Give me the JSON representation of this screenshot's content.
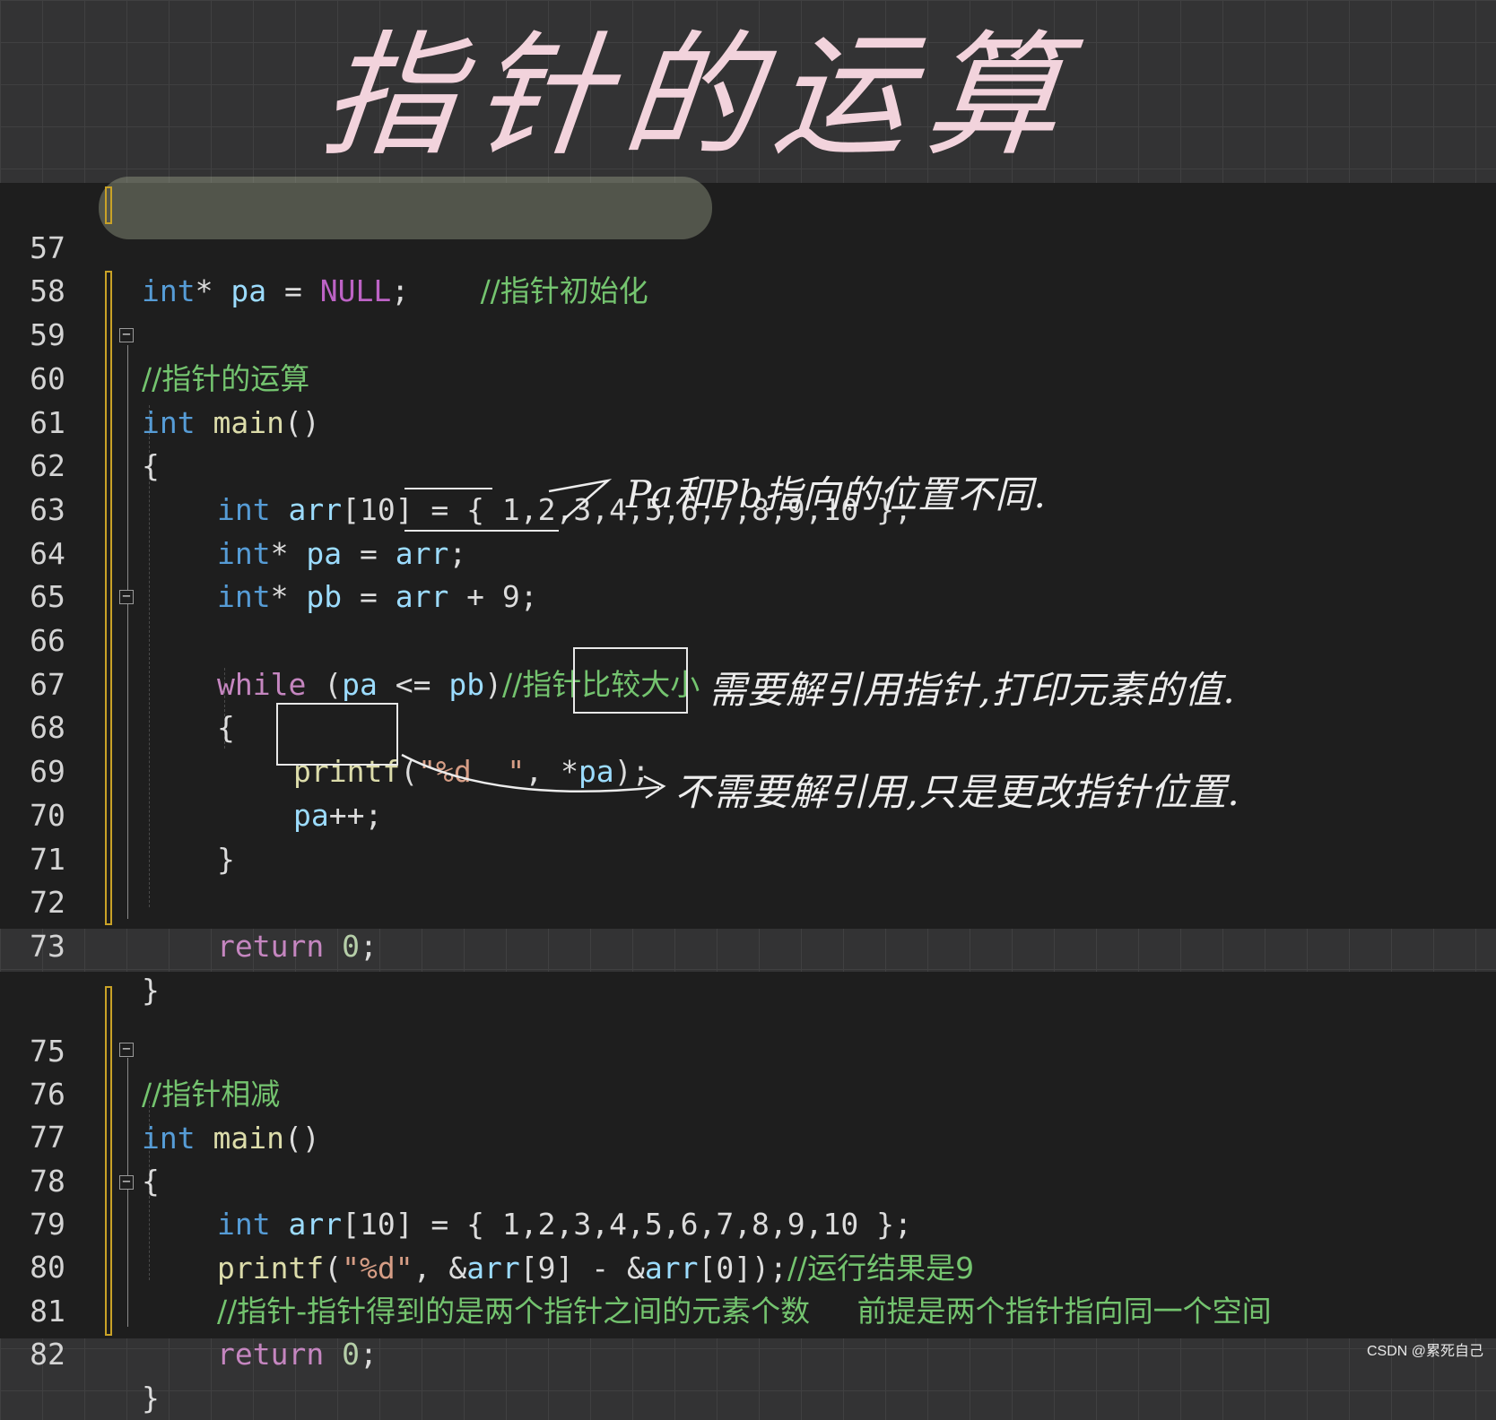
{
  "title": "指针的运算",
  "panel1": {
    "lines": [
      {
        "n": "57"
      },
      {
        "n": "58"
      },
      {
        "n": "59"
      },
      {
        "n": "60"
      },
      {
        "n": "61"
      },
      {
        "n": "62"
      },
      {
        "n": "63"
      },
      {
        "n": "64"
      },
      {
        "n": "65"
      },
      {
        "n": "66"
      },
      {
        "n": "67"
      },
      {
        "n": "68"
      },
      {
        "n": "69"
      },
      {
        "n": "70"
      },
      {
        "n": "71"
      },
      {
        "n": "72"
      },
      {
        "n": "73"
      }
    ],
    "l57": {
      "type": "int",
      "star": "*",
      "var": "pa",
      "eq": " = ",
      "val": "NULL",
      "semi": ";",
      "comment": "//指针初始化"
    },
    "l59": {
      "comment": "//指针的运算"
    },
    "l60": {
      "type": "int",
      "fn": " main",
      "rest": "()"
    },
    "l61": {
      "text": "{"
    },
    "l62": {
      "type": "int",
      "var": " arr",
      "rest": "[10] = { 1,2,3,4,5,6,7,8,9,10 };"
    },
    "l63": {
      "type": "int",
      "star": "*",
      "var": " pa",
      "eq": " = ",
      "arr": "arr",
      "semi": ";"
    },
    "l64": {
      "type": "int",
      "star": "*",
      "var": " pb",
      "eq": " = ",
      "arr": "arr",
      "rest": " + 9;"
    },
    "l66": {
      "kw": "while",
      "open": " (",
      "a": "pa",
      "op": " <= ",
      "b": "pb",
      "close": ")",
      "comment": "//指针比较大小"
    },
    "l67": {
      "text": "{"
    },
    "l68": {
      "fn": "printf",
      "open": "(",
      "str": "\"%d  \"",
      "comma": ", ",
      "star": "*",
      "var": "pa",
      "close": ");"
    },
    "l69": {
      "var": "pa",
      "rest": "++;"
    },
    "l70": {
      "text": "}"
    },
    "l72": {
      "kw": "return",
      "num": " 0",
      "semi": ";"
    },
    "l73": {
      "text": "}"
    }
  },
  "panel2": {
    "lines": [
      {
        "n": "75"
      },
      {
        "n": "76"
      },
      {
        "n": "77"
      },
      {
        "n": "78"
      },
      {
        "n": "79"
      },
      {
        "n": "80"
      },
      {
        "n": "81"
      },
      {
        "n": "82"
      }
    ],
    "l75": {
      "comment": "//指针相减"
    },
    "l76": {
      "type": "int",
      "fn": " main",
      "rest": "()"
    },
    "l77": {
      "text": "{"
    },
    "l78": {
      "type": "int",
      "var": " arr",
      "rest": "[10] = { 1,2,3,4,5,6,7,8,9,10 };"
    },
    "l79": {
      "fn": "printf",
      "open": "(",
      "str": "\"%d\"",
      "mid": ", &",
      "a": "arr",
      "idx1": "[9] - &",
      "b": "arr",
      "idx2": "[0]);",
      "comment": "//运行结果是9"
    },
    "l80": {
      "comment": "//指针-指针得到的是两个指针之间的元素个数     前提是两个指针指向同一个空间"
    },
    "l81": {
      "kw": "return",
      "num": " 0",
      "semi": ";"
    },
    "l82": {
      "text": "}"
    }
  },
  "annotations": {
    "note1": "Pa和Pb指向的位置不同.",
    "note2": "需要解引用指针,打印元素的值.",
    "note3": "不需要解引用,只是更改指针位置."
  },
  "footer": "CSDN @累死自己"
}
